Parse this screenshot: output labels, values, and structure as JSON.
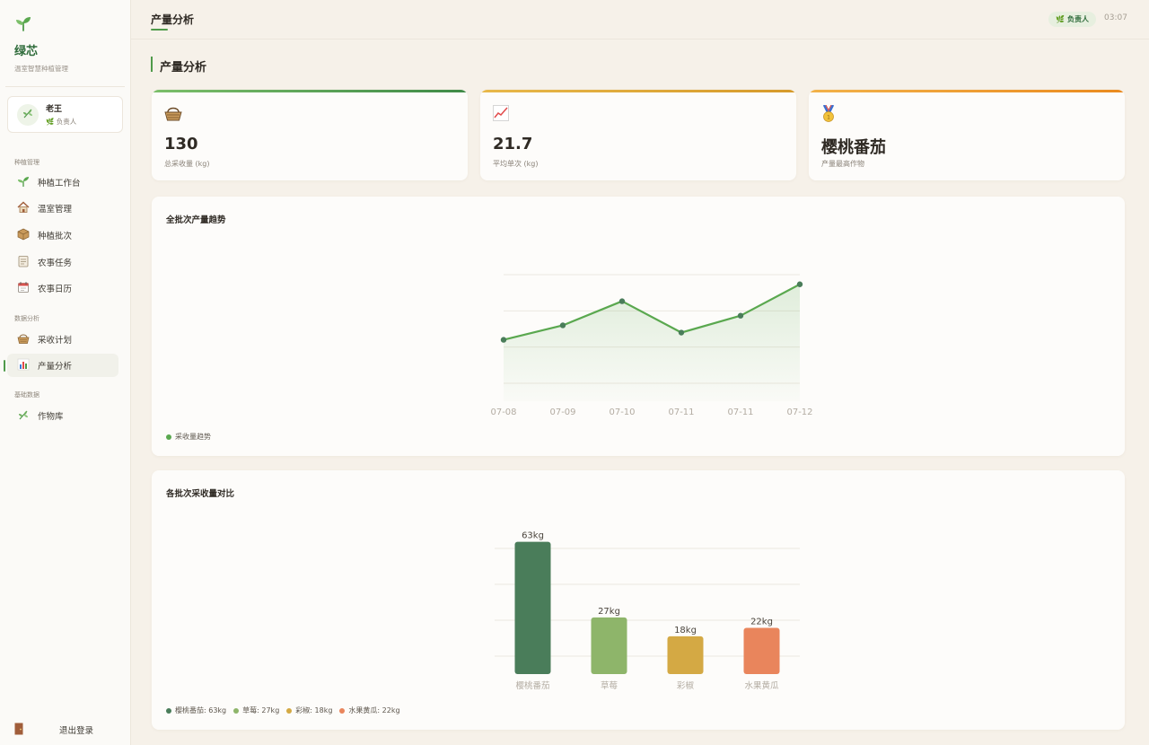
{
  "sidebar": {
    "brand": {
      "name": "绿芯",
      "subtitle": "温室智慧种植管理"
    },
    "user": {
      "name": "老王",
      "role": "负责人"
    },
    "groups": [
      {
        "label": "种植管理"
      },
      {
        "label": "数据分析"
      },
      {
        "label": "基础数据"
      }
    ],
    "items": [
      {
        "label": "种植工作台",
        "icon": "sprout-icon"
      },
      {
        "label": "温室管理",
        "icon": "house-icon"
      },
      {
        "label": "种植批次",
        "icon": "package-icon"
      },
      {
        "label": "农事任务",
        "icon": "clipboard-icon"
      },
      {
        "label": "农事日历",
        "icon": "calendar-icon"
      },
      {
        "label": "采收计划",
        "icon": "basket-icon"
      },
      {
        "label": "产量分析",
        "icon": "bar-chart-icon",
        "active": true
      },
      {
        "label": "作物库",
        "icon": "herb-icon"
      }
    ],
    "logout": {
      "label": "退出登录",
      "icon": "door-icon"
    }
  },
  "topbar": {
    "title": "产量分析",
    "role_badge": "负责人",
    "time": "03:07"
  },
  "main": {
    "section_title": "产量分析",
    "stats": [
      {
        "icon": "basket-icon",
        "value": "130",
        "label": "总采收量 (kg)",
        "accent": "#4f9a4a"
      },
      {
        "icon": "trend-up-icon",
        "value": "21.7",
        "label": "平均单次 (kg)",
        "accent": "#e0a93a"
      },
      {
        "icon": "medal-icon",
        "value": "樱桃番茄",
        "label": "产量最高作物",
        "accent": "#ec9a2a"
      }
    ]
  },
  "chart_data": [
    {
      "type": "area",
      "title": "全批次产量趋势",
      "categories": [
        "07-08",
        "07-09",
        "07-10",
        "07-11",
        "07-11",
        "07-12"
      ],
      "series": [
        {
          "name": "采收量趋势",
          "values": [
            18,
            24,
            34,
            21,
            28,
            41
          ],
          "color": "#5aa84f"
        }
      ],
      "ylim": [
        0,
        45
      ],
      "grid": true,
      "legend": "bottom-left"
    },
    {
      "type": "bar",
      "title": "各批次采收量对比",
      "categories": [
        "樱桃番茄",
        "草莓",
        "彩椒",
        "水果黄瓜"
      ],
      "values": [
        63,
        27,
        18,
        22
      ],
      "data_labels": [
        "63kg",
        "27kg",
        "18kg",
        "22kg"
      ],
      "colors": [
        "#4a7d5a",
        "#8eb56a",
        "#d4a944",
        "#e9855c"
      ],
      "legend_labels": [
        "樱桃番茄: 63kg",
        "草莓: 27kg",
        "彩椒: 18kg",
        "水果黄瓜: 22kg"
      ],
      "ylim": [
        0,
        70
      ],
      "grid": true,
      "legend": "bottom-left"
    }
  ]
}
